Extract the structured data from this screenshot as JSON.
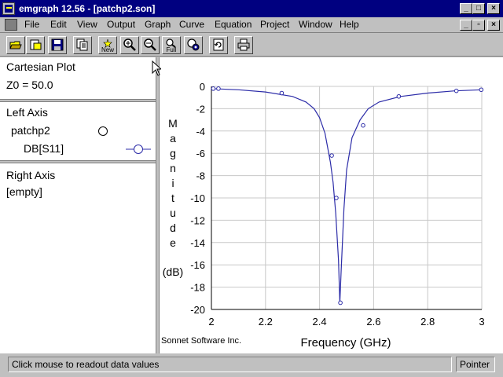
{
  "window": {
    "title": "emgraph 12.56 - [patchp2.son]",
    "controls": [
      "_",
      "□",
      "×"
    ]
  },
  "menu": {
    "items": [
      "File",
      "Edit",
      "View",
      "Output",
      "Graph",
      "Curve",
      "Equation",
      "Project",
      "Window",
      "Help"
    ],
    "doc_controls": [
      "_",
      "▫",
      "×"
    ]
  },
  "toolbar": {
    "buttons": [
      {
        "icon": "open-folder-icon"
      },
      {
        "icon": "open-project-icon"
      },
      {
        "icon": "save-icon"
      },
      {
        "icon": "copy-icon"
      },
      {
        "icon": "new-graph-icon",
        "label": "New"
      },
      {
        "icon": "zoom-in-icon"
      },
      {
        "icon": "zoom-out-icon"
      },
      {
        "icon": "zoom-full-icon",
        "label": "Full"
      },
      {
        "icon": "settings-icon"
      },
      {
        "icon": "refresh-icon"
      },
      {
        "icon": "print-icon"
      }
    ]
  },
  "left_panel": {
    "plot_type": "Cartesian Plot",
    "z0": "Z0 = 50.0",
    "left_axis": {
      "heading": "Left Axis",
      "project": "patchp2",
      "curve": "DB[S11]"
    },
    "right_axis": {
      "heading": "Right Axis",
      "value": "[empty]"
    }
  },
  "colors": {
    "curve": "#2c2ca8",
    "grid": "#c8c8c8",
    "title_bar": "#000080",
    "face": "#c0c0c0"
  },
  "chart_data": {
    "type": "line",
    "xlabel": "Frequency (GHz)",
    "ylabel_letters": [
      "M",
      "a",
      "g",
      "n",
      "i",
      "t",
      "u",
      "d",
      "e"
    ],
    "ylabel_unit": "(dB)",
    "xlim": [
      2,
      3
    ],
    "ylim": [
      -20,
      0
    ],
    "x_ticks": [
      "2",
      "2.2",
      "2.4",
      "2.6",
      "2.8",
      "3"
    ],
    "y_ticks": [
      "0",
      "-2",
      "-4",
      "-6",
      "-8",
      "-10",
      "-12",
      "-14",
      "-16",
      "-18",
      "-20"
    ],
    "grid": true,
    "credit": "Sonnet Software Inc.",
    "series": [
      {
        "x": [
          2.0,
          2.1,
          2.2,
          2.3,
          2.35,
          2.38,
          2.4,
          2.42,
          2.44,
          2.45,
          2.46,
          2.47,
          2.475,
          2.48,
          2.49,
          2.5,
          2.52,
          2.55,
          2.58,
          2.62,
          2.7,
          2.8,
          2.9,
          3.0
        ],
        "y": [
          -0.2,
          -0.3,
          -0.5,
          -0.9,
          -1.4,
          -2.0,
          -2.8,
          -4.2,
          -6.8,
          -8.6,
          -11.4,
          -15.6,
          -19.4,
          -16.5,
          -11.0,
          -7.5,
          -4.6,
          -3.0,
          -2.0,
          -1.4,
          -0.9,
          -0.6,
          -0.4,
          -0.3
        ]
      }
    ],
    "markers": {
      "x": [
        2.007,
        2.026,
        2.26,
        2.445,
        2.462,
        2.477,
        2.561,
        2.693,
        2.906,
        2.998
      ],
      "y": [
        -0.2,
        -0.2,
        -0.6,
        -6.2,
        -10.0,
        -19.4,
        -3.5,
        -0.9,
        -0.4,
        -0.3
      ]
    }
  },
  "status": {
    "message": "Click mouse to readout data values",
    "mode": "Pointer"
  }
}
